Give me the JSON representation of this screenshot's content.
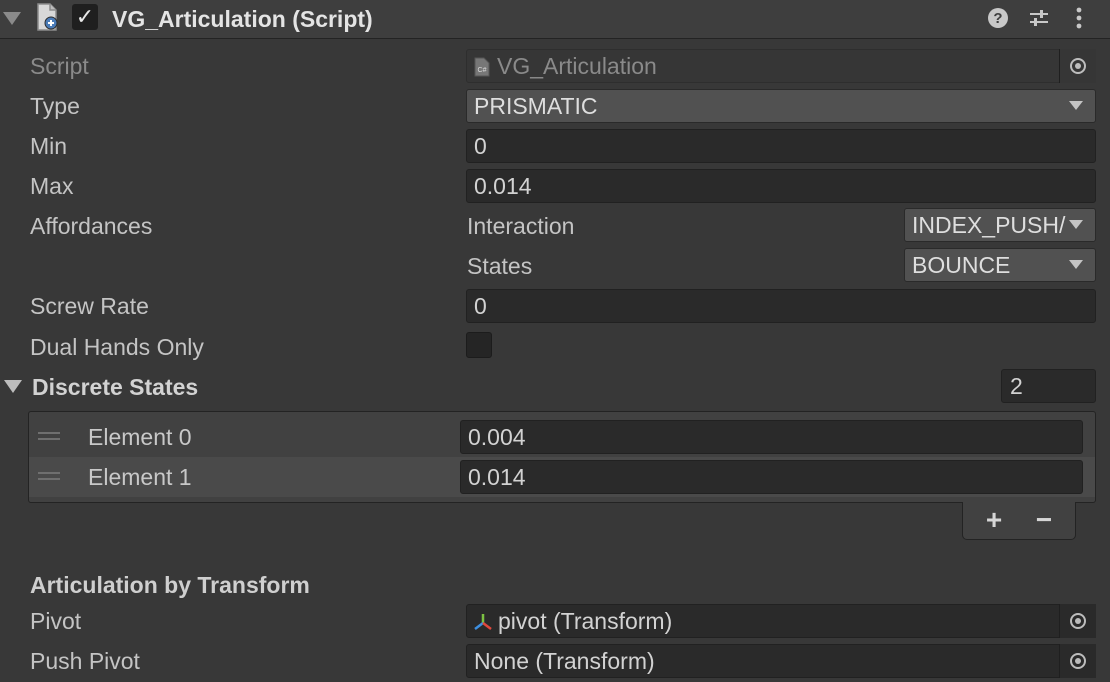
{
  "component": {
    "title": "VG_Articulation (Script)",
    "enabled": true,
    "icons": [
      "fold-arrow-icon",
      "script-file-icon",
      "help-icon",
      "presets-icon",
      "kebab-menu-icon"
    ]
  },
  "fields": {
    "script": {
      "label": "Script",
      "value": "VG_Articulation",
      "icon": "csharp-script-icon"
    },
    "type": {
      "label": "Type",
      "value": "PRISMATIC"
    },
    "min": {
      "label": "Min",
      "value": "0"
    },
    "max": {
      "label": "Max",
      "value": "0.014"
    },
    "affordances": {
      "label": "Affordances",
      "interaction_label": "Interaction",
      "interaction_value": "INDEX_PUSH/",
      "states_label": "States",
      "states_value": "BOUNCE"
    },
    "screw_rate": {
      "label": "Screw Rate",
      "value": "0"
    },
    "dual_hands_only": {
      "label": "Dual Hands Only",
      "checked": false
    }
  },
  "discrete_states": {
    "label": "Discrete States",
    "size": "2",
    "elements": [
      {
        "label": "Element 0",
        "value": "0.004"
      },
      {
        "label": "Element 1",
        "value": "0.014"
      }
    ],
    "add_label": "+",
    "remove_label": "−"
  },
  "articulation_by_transform": {
    "title": "Articulation by Transform",
    "pivot": {
      "label": "Pivot",
      "value": "pivot (Transform)",
      "icon": "transform-axes-icon"
    },
    "push_pivot": {
      "label": "Push Pivot",
      "value": "None (Transform)"
    }
  },
  "colors": {
    "background": "#383838",
    "field": "#2a2a2a",
    "dropdown": "#515151",
    "text": "#d2d2d2"
  }
}
